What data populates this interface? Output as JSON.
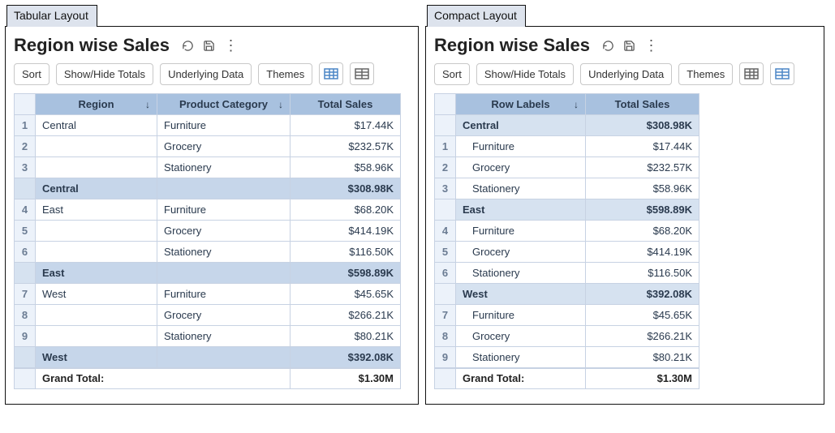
{
  "tabs": {
    "left": "Tabular Layout",
    "right": "Compact Layout"
  },
  "header": {
    "title": "Region wise Sales"
  },
  "toolbar": {
    "sort": "Sort",
    "totals": "Show/Hide Totals",
    "underlying": "Underlying Data",
    "themes": "Themes"
  },
  "columns": {
    "region": "Region",
    "product_category": "Product Category",
    "total_sales": "Total Sales",
    "row_labels": "Row Labels"
  },
  "regions": [
    {
      "name": "Central",
      "subtotal": "$308.98K",
      "items": [
        {
          "n": "1",
          "cat": "Furniture",
          "val": "$17.44K"
        },
        {
          "n": "2",
          "cat": "Grocery",
          "val": "$232.57K"
        },
        {
          "n": "3",
          "cat": "Stationery",
          "val": "$58.96K"
        }
      ]
    },
    {
      "name": "East",
      "subtotal": "$598.89K",
      "items": [
        {
          "n": "4",
          "cat": "Furniture",
          "val": "$68.20K"
        },
        {
          "n": "5",
          "cat": "Grocery",
          "val": "$414.19K"
        },
        {
          "n": "6",
          "cat": "Stationery",
          "val": "$116.50K"
        }
      ]
    },
    {
      "name": "West",
      "subtotal": "$392.08K",
      "items": [
        {
          "n": "7",
          "cat": "Furniture",
          "val": "$45.65K"
        },
        {
          "n": "8",
          "cat": "Grocery",
          "val": "$266.21K"
        },
        {
          "n": "9",
          "cat": "Stationery",
          "val": "$80.21K"
        }
      ]
    }
  ],
  "grand_total": {
    "label": "Grand Total:",
    "value": "$1.30M"
  }
}
